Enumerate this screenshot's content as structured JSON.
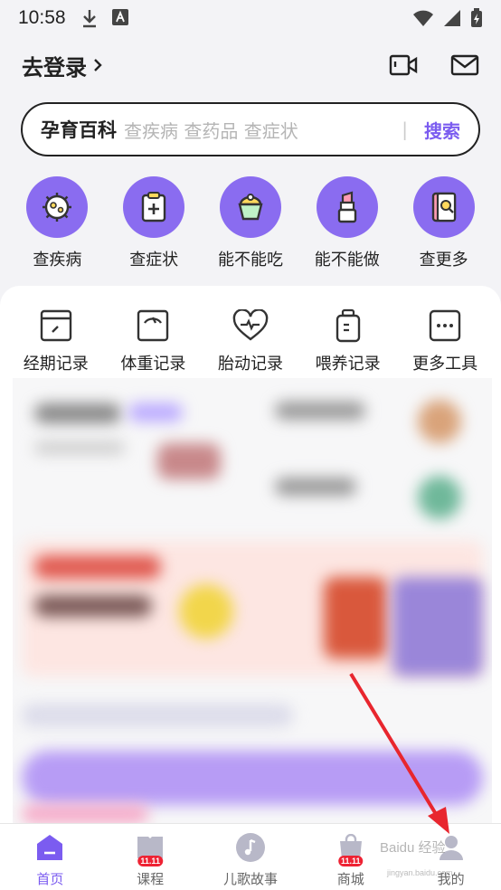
{
  "status_bar": {
    "time": "10:58"
  },
  "header": {
    "login_label": "去登录"
  },
  "search": {
    "brand": "孕育百科",
    "placeholder": "查疾病 查药品 查症状",
    "divider": "|",
    "button": "搜索"
  },
  "quick_actions": [
    {
      "label": "查疾病",
      "icon": "virus-icon"
    },
    {
      "label": "查症状",
      "icon": "clipboard-cross-icon"
    },
    {
      "label": "能不能吃",
      "icon": "cupcake-icon"
    },
    {
      "label": "能不能做",
      "icon": "lipstick-icon"
    },
    {
      "label": "查更多",
      "icon": "book-search-icon"
    }
  ],
  "tools": [
    {
      "label": "经期记录",
      "icon": "calendar-pencil-icon"
    },
    {
      "label": "体重记录",
      "icon": "scale-icon"
    },
    {
      "label": "胎动记录",
      "icon": "heartbeat-icon"
    },
    {
      "label": "喂养记录",
      "icon": "baby-bottle-icon"
    },
    {
      "label": "更多工具",
      "icon": "more-dots-icon"
    }
  ],
  "tabbar": [
    {
      "label": "首页",
      "icon": "home-icon",
      "active": true
    },
    {
      "label": "课程",
      "icon": "course-book-icon",
      "badge": "11.11"
    },
    {
      "label": "儿歌故事",
      "icon": "music-note-icon"
    },
    {
      "label": "商城",
      "icon": "shopping-bag-icon",
      "badge": "11.11"
    },
    {
      "label": "我的",
      "icon": "user-icon"
    }
  ],
  "colors": {
    "accent": "#7b5cf0",
    "quick_circle": "#8a6cf0",
    "arrow": "#e8262e"
  },
  "watermark": {
    "text": "Baidu 经验",
    "sub": "jingyan.baidu.com"
  }
}
